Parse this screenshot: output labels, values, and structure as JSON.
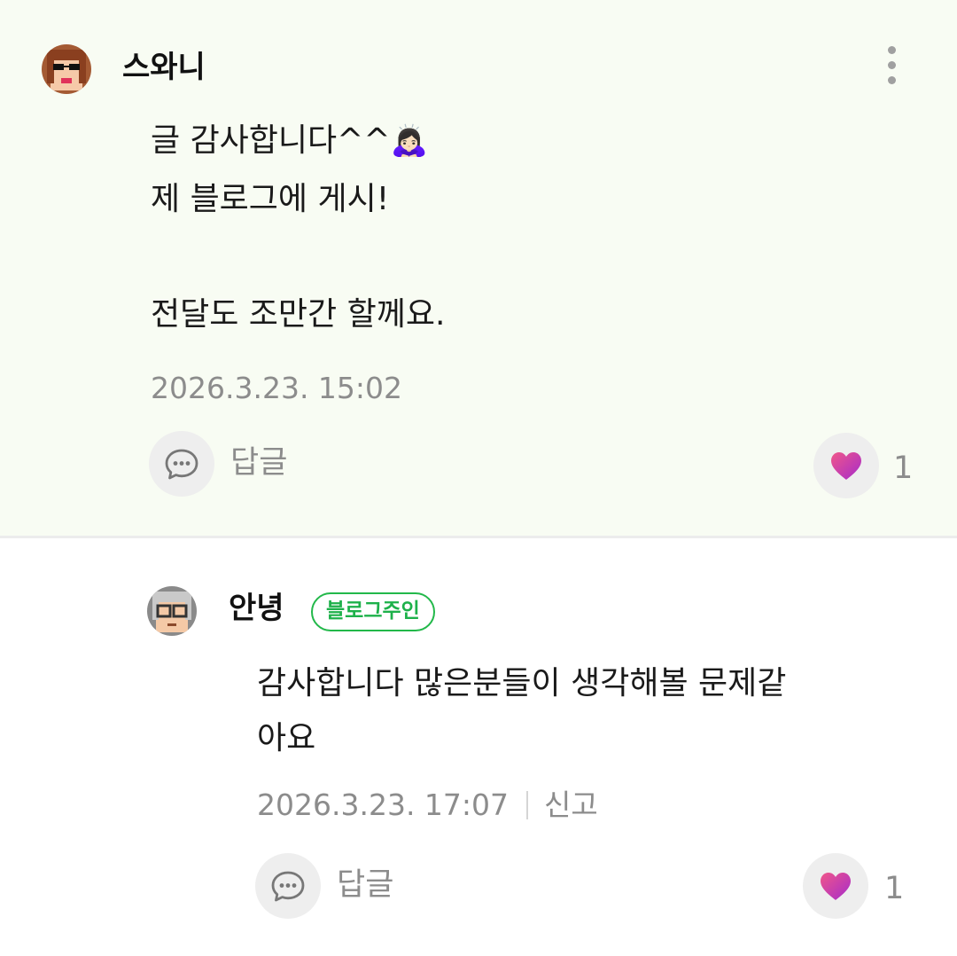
{
  "comments": [
    {
      "author": "스와니",
      "text": "글 감사합니다^^",
      "emoji": "🙇🏻‍♀️",
      "text2": "제 블로그에 게시!",
      "text3": "전달도 조만간 할께요.",
      "timestamp": "2026.3.23. 15:02",
      "reply_label": "답글",
      "like_count": "1"
    },
    {
      "author": "안녕",
      "badge": "블로그주인",
      "text_line1": "감사합니다 많은분들이 생각해볼 문제같",
      "text_line2": "아요",
      "timestamp": "2026.3.23. 17:07",
      "report_label": "신고",
      "reply_label": "답글",
      "like_count": "1"
    }
  ],
  "colors": {
    "highlight_bg": "#f8fcf3",
    "badge_green": "#1db14a",
    "heart_gradient": [
      "#e34f8e",
      "#b22cc7"
    ]
  },
  "icons": [
    "more-vertical-icon",
    "speech-bubble-icon",
    "heart-icon"
  ]
}
